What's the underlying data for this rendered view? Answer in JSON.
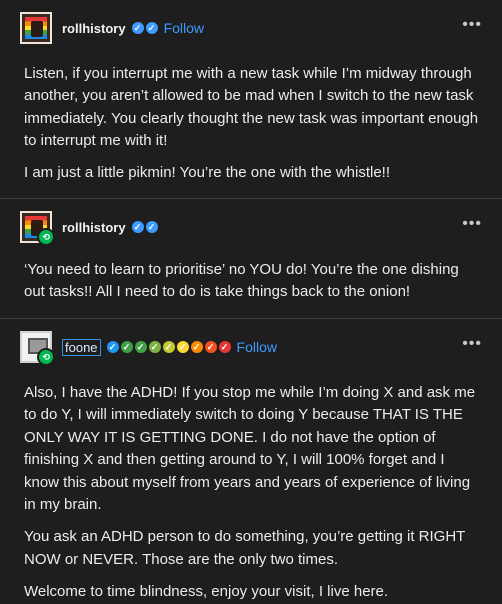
{
  "posts": [
    {
      "username": "rollhistory",
      "follow_label": "Follow",
      "more_label": "•••",
      "paragraphs": [
        "Listen, if you interrupt me with a new task while I’m midway through another, you aren’t allowed to be mad when I switch to the new task immediately. You clearly thought the new task was important enough to interrupt me with it!",
        "I am just a little pikmin! You’re the one with the whistle!!"
      ]
    },
    {
      "username": "rollhistory",
      "more_label": "•••",
      "paragraphs": [
        "‘You need to learn to prioritise’ no YOU do! You’re the one dishing out tasks!! All I need to do is take things back to the onion!"
      ]
    },
    {
      "username": "foone",
      "follow_label": "Follow",
      "more_label": "•••",
      "badge_colors": [
        "#2196f3",
        "#43a047",
        "#43a047",
        "#7cb342",
        "#c0ca33",
        "#fdd835",
        "#fb8c00",
        "#f4511e",
        "#e53935"
      ],
      "paragraphs": [
        "Also, I have the ADHD! If you stop me while I’m doing X and ask me to do Y, I will immediately switch to doing Y because THAT IS THE ONLY WAY IT IS GETTING DONE. I do not have the option of finishing X and then getting around to Y, I will 100% forget and I know this about myself from years and years of experience of living in my brain.",
        "You ask an ADHD person to do something, you’re getting it RIGHT NOW or NEVER. Those are the only two times.",
        "Welcome to time blindness, enjoy your visit, I live here."
      ]
    }
  ],
  "colors": {
    "accent": "#3d9bff",
    "reblog": "#00b850",
    "background": "#1e1e1e"
  }
}
